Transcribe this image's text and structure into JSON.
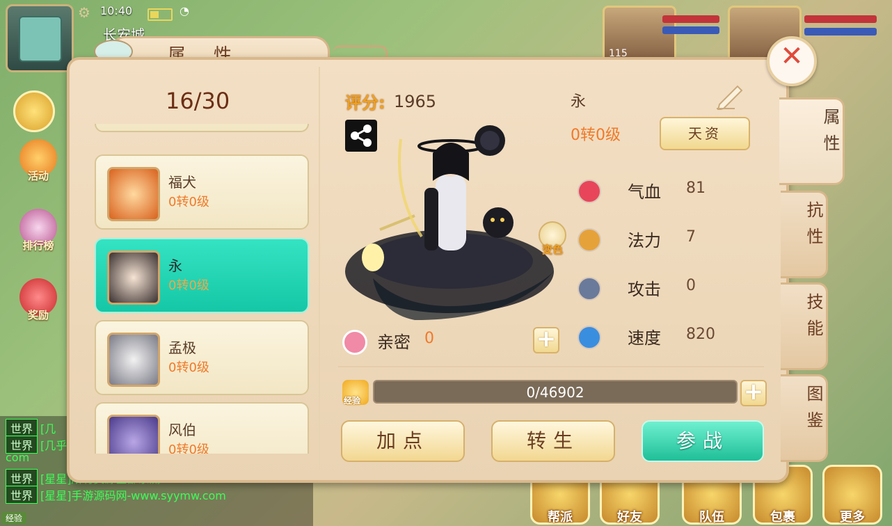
{
  "status": {
    "time": "10:40",
    "city": "长安城"
  },
  "left_menu": [
    {
      "label": "活动"
    },
    {
      "label": "排行榜"
    },
    {
      "label": "奖励"
    }
  ],
  "chat": {
    "lines": [
      {
        "channel": "世界",
        "text": "[几"
      },
      {
        "channel": "世界",
        "text": "[几乎"
      },
      {
        "channel": "",
        "text": "com"
      },
      {
        "channel": "世界",
        "text": "[星星]所有资源全部系测"
      },
      {
        "channel": "世界",
        "text": "[星星]手游源码网-www.syymw.com"
      }
    ],
    "exp_tag": "经验"
  },
  "team": {
    "member1_level": "115"
  },
  "bottom_menu": [
    {
      "label": "帮派"
    },
    {
      "label": "好友"
    },
    {
      "label": "队伍"
    },
    {
      "label": "包裹"
    },
    {
      "label": "更多"
    }
  ],
  "panel": {
    "title": "属性",
    "count": "16/30",
    "pets": [
      {
        "name": "福犬",
        "level": "0转0级",
        "selected": false
      },
      {
        "name": "永",
        "level": "0转0级",
        "selected": true
      },
      {
        "name": "孟极",
        "level": "0转0级",
        "selected": false
      },
      {
        "name": "风伯",
        "level": "0转0级",
        "selected": false
      }
    ],
    "score_label": "评分:",
    "score_value": "1965",
    "selected_name": "永",
    "selected_level": "0转0级",
    "talent_button": "天资",
    "stats": [
      {
        "label": "气血",
        "value": "81",
        "icon": "heart-icon",
        "color": "#e8455a"
      },
      {
        "label": "法力",
        "value": "7",
        "icon": "mana-icon",
        "color": "#e6a23a"
      },
      {
        "label": "攻击",
        "value": "0",
        "icon": "sword-icon",
        "color": "#6a7a9a"
      },
      {
        "label": "速度",
        "value": "820",
        "icon": "lightning-icon",
        "color": "#3a8ee0"
      }
    ],
    "intimacy_label": "亲密",
    "intimacy_value": "0",
    "exp_label": "经验",
    "exp_text": "0/46902",
    "buttons": {
      "add_points": "加点",
      "rebirth": "转生",
      "battle": "参战"
    },
    "side_tabs": [
      {
        "label": "属性",
        "active": true
      },
      {
        "label": "抗性",
        "active": false
      },
      {
        "label": "技能",
        "active": false
      },
      {
        "label": "图鉴",
        "active": false
      }
    ],
    "transform_label": "变色"
  },
  "colors": {
    "accent_teal": "#1fc7a5",
    "level_orange": "#f07a2a",
    "score_gold": "#f0a020",
    "close_red": "#e04a3a"
  }
}
